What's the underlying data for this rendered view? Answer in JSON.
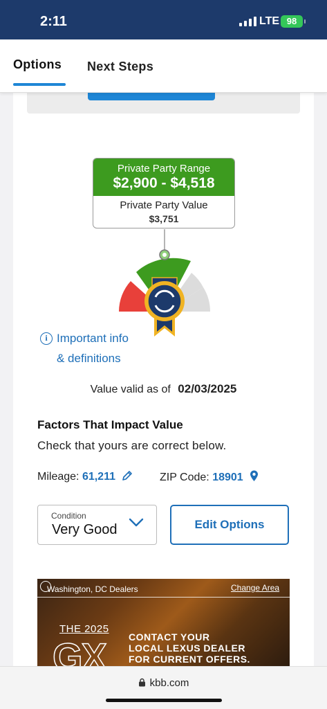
{
  "status_bar": {
    "time": "2:11",
    "network": "LTE",
    "battery": "98"
  },
  "tabs": [
    {
      "label": "Options",
      "active": true
    },
    {
      "label": "Next Steps",
      "active": false
    }
  ],
  "valuation": {
    "range_label": "Private Party Range",
    "range_value": "$2,900 - $4,518",
    "value_label": "Private Party Value",
    "value_amount": "$3,751",
    "colors": {
      "range_green": "#3d9b1f",
      "gauge_red": "#e8403a",
      "gauge_gray": "#dcdcdc",
      "badge_navy": "#1d3a6b",
      "badge_gold": "#f0b323"
    }
  },
  "info": {
    "icon": "info-icon",
    "line1": "Important info",
    "line2": "& definitions"
  },
  "valid": {
    "label": "Value valid as of",
    "date": "02/03/2025"
  },
  "factors": {
    "title": "Factors That Impact Value",
    "subtitle": "Check that yours are correct below.",
    "mileage_label": "Mileage:",
    "mileage_value": "61,211",
    "zip_label": "ZIP Code:",
    "zip_value": "18901"
  },
  "condition": {
    "label": "Condition",
    "value": "Very Good"
  },
  "edit_options_label": "Edit Options",
  "ad": {
    "dealers": "Washington, DC Dealers",
    "change_area": "Change Area",
    "year": "THE 2025",
    "model": "GX",
    "cta_line1": "CONTACT YOUR",
    "cta_line2": "LOCAL LEXUS DEALER",
    "cta_line3": "FOR CURRENT OFFERS."
  },
  "browser": {
    "url": "kbb.com"
  },
  "accent_color": "#1e6fb8"
}
